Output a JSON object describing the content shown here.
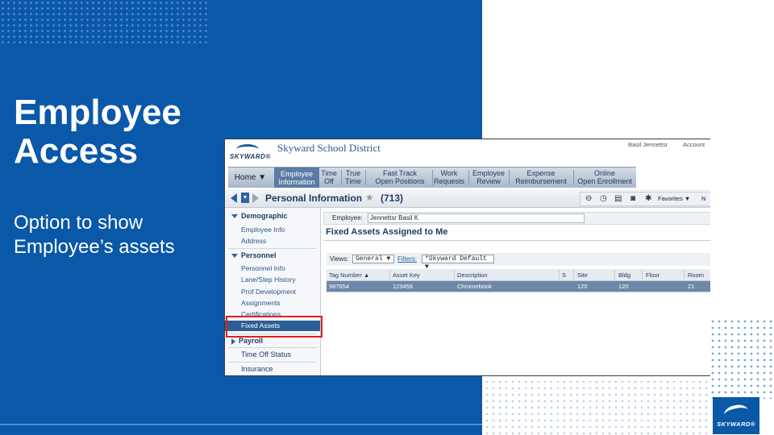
{
  "slide": {
    "title_lines": [
      "Employee",
      "Access"
    ],
    "body_lines": [
      "Option to show",
      "Employee’s assets"
    ],
    "logo_text": "SKYWARD®"
  },
  "app": {
    "logo_text": "SKYWARD®",
    "district_name": "Skyward School District",
    "header_links": [
      "Basil Jennettsr",
      "Account"
    ],
    "nav": {
      "home": "Home ▼",
      "items": [
        [
          "Employee",
          "Information"
        ],
        [
          "Time",
          "Off"
        ],
        [
          "True",
          "Time"
        ],
        [
          "Fast Track",
          "Open Positions"
        ],
        [
          "Work",
          "Requests"
        ],
        [
          "Employee",
          "Review"
        ],
        [
          "Expense",
          "Reimbursement"
        ],
        [
          "Online",
          "Open Enrollment"
        ]
      ]
    },
    "page_title": "Personal Information",
    "page_code": "(713)",
    "favorites_label": "Favorites ▼",
    "favorites_extra": "N",
    "sidenav": {
      "demographic": "Demographic",
      "demographic_items": [
        "Employee Info",
        "Address"
      ],
      "personnel": "Personnel",
      "personnel_items": [
        "Personnel Info",
        "Lane/Step History",
        "Prof Development",
        "Assignments",
        "Certifications",
        "Fixed Assets"
      ],
      "payroll": "Payroll",
      "time_off_status": "Time Off Status",
      "insurance": "Insurance"
    },
    "employee_label": "Employee:",
    "employee_value": "Jennettsr Basil K",
    "section_title": "Fixed Assets Assigned to Me",
    "views_label": "Views:",
    "views_value": "General ▼",
    "filters_label": "Filters:",
    "filters_value": "*Skyward Default ▼",
    "table": {
      "columns": [
        "Tag Number ▲",
        "Asset Key",
        "Description",
        "S",
        "Site",
        "Bldg",
        "Floor",
        "Room"
      ],
      "rows": [
        [
          "987654",
          "123456",
          "Chromebook",
          "",
          "120",
          "120",
          "",
          "21"
        ]
      ]
    }
  },
  "colors": {
    "slide_blue": "#0a58a8",
    "selection_blue": "#2c5d94",
    "highlight_red": "#e02020"
  }
}
